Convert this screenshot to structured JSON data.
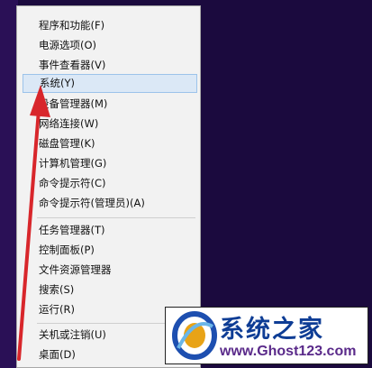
{
  "context_menu": {
    "group1": [
      {
        "label": "程序和功能(F)"
      },
      {
        "label": "电源选项(O)"
      },
      {
        "label": "事件查看器(V)"
      },
      {
        "label": "系统(Y)"
      },
      {
        "label": "设备管理器(M)"
      },
      {
        "label": "网络连接(W)"
      },
      {
        "label": "磁盘管理(K)"
      },
      {
        "label": "计算机管理(G)"
      },
      {
        "label": "命令提示符(C)"
      },
      {
        "label": "命令提示符(管理员)(A)"
      }
    ],
    "group2": [
      {
        "label": "任务管理器(T)"
      },
      {
        "label": "控制面板(P)"
      },
      {
        "label": "文件资源管理器"
      },
      {
        "label": "搜索(S)"
      },
      {
        "label": "运行(R)"
      }
    ],
    "group3": [
      {
        "label": "关机或注销(U)"
      },
      {
        "label": "桌面(D)"
      }
    ],
    "highlighted_item": "系统(Y)"
  },
  "watermark": {
    "title": "系统之家",
    "url": "www.Ghost123.com"
  },
  "colors": {
    "desktop": "#1b0a3e",
    "menu_bg": "#f2f2f2",
    "highlight_bg": "#dbe8f6",
    "highlight_border": "#9cc3ea",
    "arrow": "#d8262b",
    "logo_text": "#0e3d95"
  }
}
